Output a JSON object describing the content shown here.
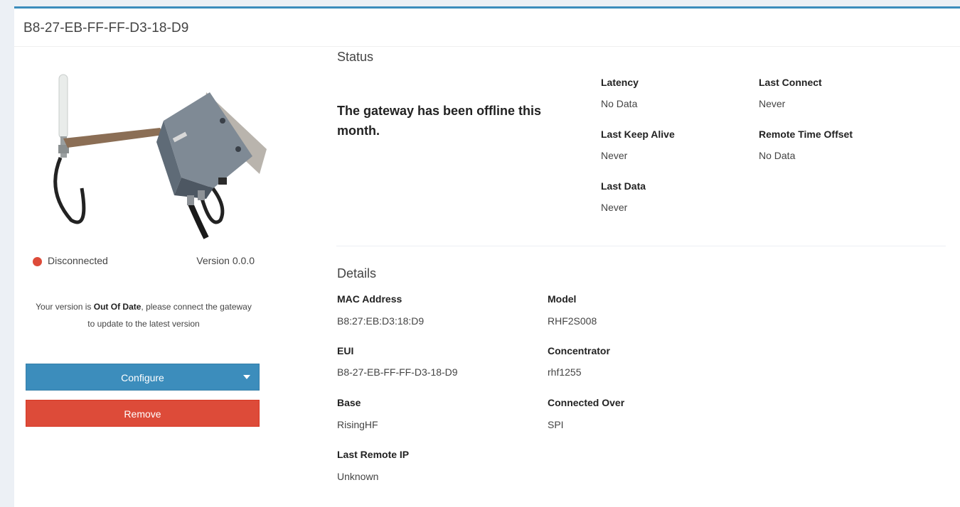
{
  "header": {
    "title": "B8-27-EB-FF-FF-D3-18-D9"
  },
  "gateway": {
    "connection_status": "Disconnected",
    "status_color": "#dd4b39",
    "version": "Version 0.0.0",
    "outdated_prefix": "Your version is ",
    "outdated_emphasis": "Out Of Date",
    "outdated_suffix": ", please connect the gateway to update to the latest version",
    "configure_label": "Configure",
    "remove_label": "Remove"
  },
  "status": {
    "title": "Status",
    "message": "The gateway has been offline this month.",
    "stats": [
      {
        "label": "Latency",
        "value": "No Data"
      },
      {
        "label": "Last Connect",
        "value": "Never"
      },
      {
        "label": "Last Keep Alive",
        "value": "Never"
      },
      {
        "label": "Remote Time Offset",
        "value": "No Data"
      },
      {
        "label": "Last Data",
        "value": "Never"
      }
    ]
  },
  "details": {
    "title": "Details",
    "fields": [
      {
        "label": "MAC Address",
        "value": "B8:27:EB:D3:18:D9"
      },
      {
        "label": "Model",
        "value": "RHF2S008"
      },
      {
        "label": "EUI",
        "value": "B8-27-EB-FF-FF-D3-18-D9"
      },
      {
        "label": "Concentrator",
        "value": "rhf1255"
      },
      {
        "label": "Base",
        "value": "RisingHF"
      },
      {
        "label": "Connected Over",
        "value": "SPI"
      },
      {
        "label": "Last Remote IP",
        "value": "Unknown"
      }
    ]
  },
  "colors": {
    "accent": "#3c8dbc",
    "danger": "#dd4b39",
    "background": "#ecf0f5"
  }
}
